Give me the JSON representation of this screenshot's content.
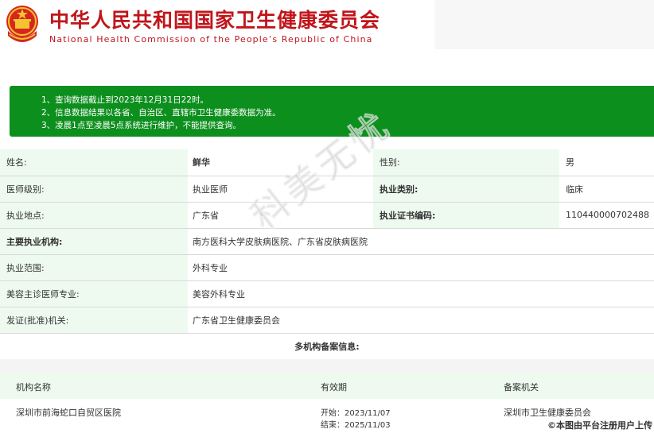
{
  "header": {
    "title_cn": "中华人民共和国国家卫生健康委员会",
    "title_en": "National Health Commission of the People’s Republic of China",
    "brand_color": "#c0151b",
    "emblem_icon": "national-emblem-icon"
  },
  "notice": {
    "background": "#0d8f1e",
    "lines": [
      "1、查询数据截止到2023年12月31日22时。",
      "2、信息数据结果以各省、自治区、直辖市卫生健康委数据为准。",
      "3、凌晨1点至凌晨5点系统进行维护，不能提供查询。"
    ]
  },
  "info": {
    "name_label": "姓名:",
    "name_value": "鲜华",
    "gender_label": "性别:",
    "gender_value": "男",
    "level_label": "医师级别:",
    "level_value": "执业医师",
    "category_label": "执业类别:",
    "category_value": "临床",
    "location_label": "执业地点:",
    "location_value": "广东省",
    "cert_label": "执业证书编码:",
    "cert_value": "110440000702488",
    "org_label": "主要执业机构:",
    "org_value": "南方医科大学皮肤病医院、广东省皮肤病医院",
    "scope_label": "执业范围:",
    "scope_value": "外科专业",
    "cosmetic_label": "美容主诊医师专业:",
    "cosmetic_value": "美容外科专业",
    "issuer_label": "发证(批准)机关:",
    "issuer_value": "广东省卫生健康委员会"
  },
  "multi": {
    "title": "多机构备案信息:",
    "col_name": "机构名称",
    "col_valid": "有效期",
    "col_authority": "备案机关",
    "row": {
      "name": "深圳市前海蛇口自贸区医院",
      "start": "开始：2023/11/07",
      "end": "结束：2025/11/03",
      "authority": "深圳市卫生健康委员会"
    }
  },
  "watermark": "科美无忧",
  "credit": "©本图由平台注册用户上传"
}
